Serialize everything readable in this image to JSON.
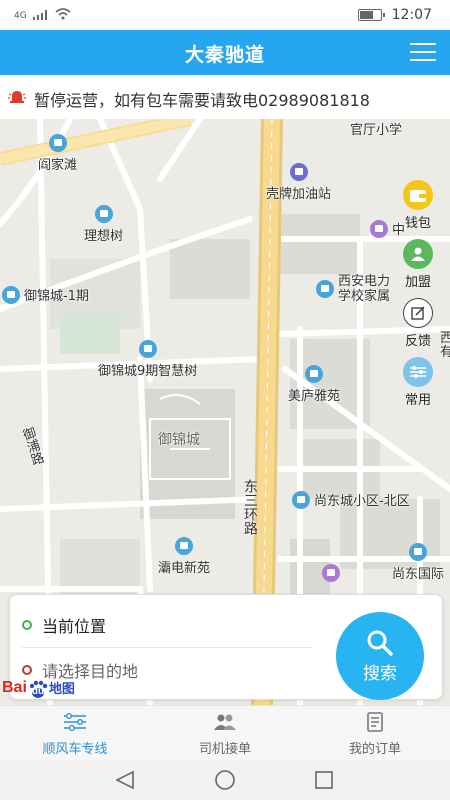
{
  "statusbar": {
    "network": "4G",
    "time": "12:07"
  },
  "header": {
    "title": "大秦驰道",
    "menu_icon": "hamburger-icon"
  },
  "notice": {
    "text": "暂停运营，如有包车需要请致电02989081818",
    "icon": "bell-icon"
  },
  "map": {
    "pois": [
      {
        "label": "阎家滩"
      },
      {
        "label": "理想树"
      },
      {
        "label": "御锦城-1期"
      },
      {
        "label": "御锦城9期智慧树"
      },
      {
        "label": "壳牌加油站"
      },
      {
        "label": "官厅小学"
      },
      {
        "label": "西安电力"
      },
      {
        "label": "学校家属"
      },
      {
        "label": "美庐雅苑"
      },
      {
        "label": "尚东城小区-北区"
      },
      {
        "label": "尚东国际"
      },
      {
        "label": "灞电新苑"
      },
      {
        "label": "御锦城"
      },
      {
        "label": "中"
      },
      {
        "label": "西"
      },
      {
        "label": "有"
      }
    ],
    "roads": {
      "yupu": "御浦路",
      "dongsanhuan": "东三环路"
    }
  },
  "sidetools": [
    {
      "label": "钱包",
      "icon": "wallet-icon",
      "color": "#f5c518"
    },
    {
      "label": "加盟",
      "icon": "join-icon",
      "color": "#5cb85c"
    },
    {
      "label": "反馈",
      "icon": "feedback-icon",
      "color": "#ffffff"
    },
    {
      "label": "常用",
      "icon": "settings-sliders-icon",
      "color": "#7ec3ea"
    }
  ],
  "panel": {
    "current_location": "当前位置",
    "destination_placeholder": "请选择目的地",
    "search_label": "搜索"
  },
  "baidu": {
    "text_bai": "Bai",
    "text_du": "du",
    "text_map": "地图"
  },
  "tabs": [
    {
      "label": "顺风车专线",
      "active": true
    },
    {
      "label": "司机接单",
      "active": false
    },
    {
      "label": "我的订单",
      "active": false
    }
  ],
  "colors": {
    "primary": "#27a6f0",
    "search": "#27b4f0",
    "active_tab": "#2b8fd6"
  }
}
